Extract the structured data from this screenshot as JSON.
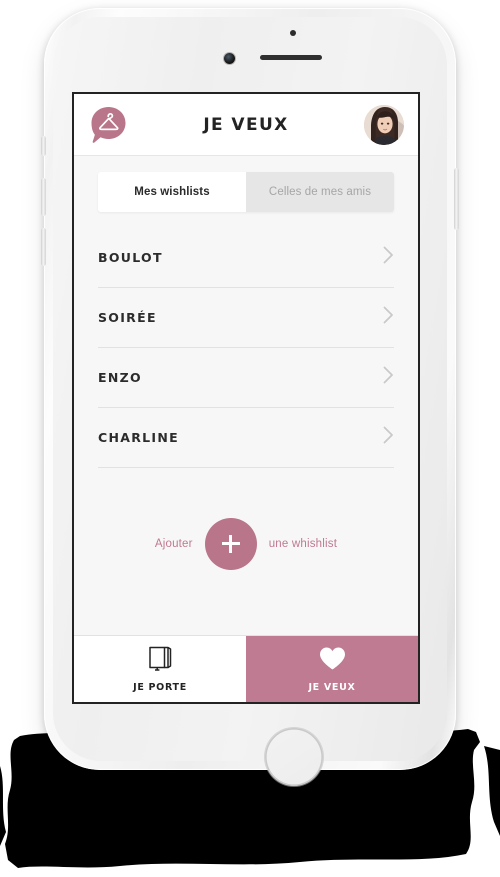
{
  "device": {
    "kind": "smartphone",
    "color_name": "white-silver",
    "hardware": {
      "camera": "front-camera-icon",
      "sensor": "proximity-sensor-icon",
      "speaker": "earpiece-speaker-icon",
      "home_button": "home-button-icon",
      "silent_switch": "silent-switch-button",
      "volume_up": "volume-up-button",
      "volume_down": "volume-down-button",
      "power": "power-button"
    }
  },
  "colors": {
    "brand_pink": "#b97589",
    "nav_active_pink": "#be7b91",
    "text_dark": "#2c2c2c",
    "text_muted": "#a6a6a6",
    "screen_bg": "#f7f7f7",
    "divider": "#e2e2e2",
    "white": "#ffffff"
  },
  "header": {
    "logo_icon": "hanger-speech-bubble-logo-icon",
    "title": "JE VEUX",
    "avatar_icon": "user-avatar"
  },
  "tabs": [
    {
      "label": "Mes wishlists",
      "active": true
    },
    {
      "label": "Celles de mes amis",
      "active": false
    }
  ],
  "wishlists": [
    {
      "label": "BOULOT",
      "chevron": "chevron-right-icon"
    },
    {
      "label": "SOIRÉE",
      "chevron": "chevron-right-icon"
    },
    {
      "label": "ENZO",
      "chevron": "chevron-right-icon"
    },
    {
      "label": "CHARLINE",
      "chevron": "chevron-right-icon"
    }
  ],
  "add_wishlist": {
    "text_before": "Ajouter",
    "button_icon": "plus-icon",
    "text_after": "une whishlist"
  },
  "bottom_nav": [
    {
      "label": "JE PORTE",
      "icon": "wardrobe-book-icon",
      "active": false
    },
    {
      "label": "JE VEUX",
      "icon": "heart-icon",
      "active": true
    }
  ]
}
